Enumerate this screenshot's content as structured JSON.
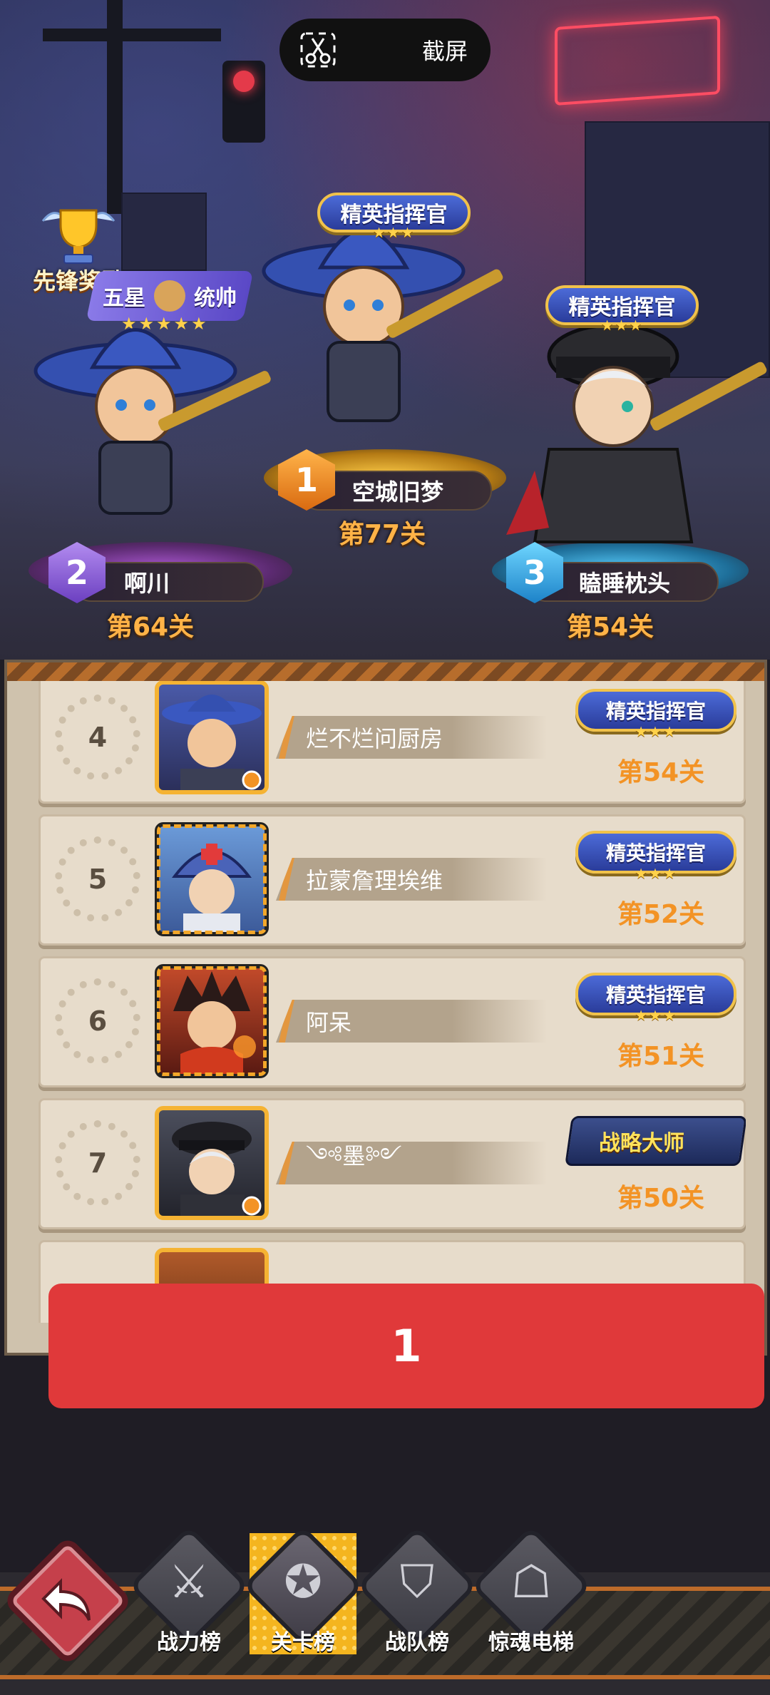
{
  "screenshot": {
    "label": "截屏"
  },
  "vanguard": {
    "label": "先锋奖励",
    "rank_title": "五星",
    "rank_title2": "统帅",
    "stars": "★★★★★"
  },
  "podium": [
    {
      "rank": "1",
      "name": "空城旧梦",
      "level": "第77关",
      "title": "精英指挥官",
      "stars": "★★★"
    },
    {
      "rank": "2",
      "name": "啊川",
      "level": "第64关"
    },
    {
      "rank": "3",
      "name": "瞌睡枕头",
      "level": "第54关",
      "title": "精英指挥官",
      "stars": "★★★"
    }
  ],
  "list": [
    {
      "rank": "4",
      "name": "烂不烂问厨房",
      "title": "精英指挥官",
      "stars": "★★★",
      "level": "第54关"
    },
    {
      "rank": "5",
      "name": "拉蒙詹理埃维",
      "title": "精英指挥官",
      "stars": "★★★",
      "level": "第52关"
    },
    {
      "rank": "6",
      "name": "阿呆",
      "title": "精英指挥官",
      "stars": "★★★",
      "level": "第51关"
    },
    {
      "rank": "7",
      "name": "༺墨༻",
      "title": "战略大师",
      "level": "第50关"
    }
  ],
  "popup": {
    "value": "1"
  },
  "nav": {
    "items": [
      {
        "label": "战力榜"
      },
      {
        "label": "关卡榜"
      },
      {
        "label": "战队榜"
      },
      {
        "label": "惊魂电梯"
      }
    ]
  },
  "colors": {
    "accent_gold": "#f4b51f",
    "level_orange": "#f39325",
    "popup_red": "#e0393a",
    "panel_bg": "#cfc2ad"
  }
}
